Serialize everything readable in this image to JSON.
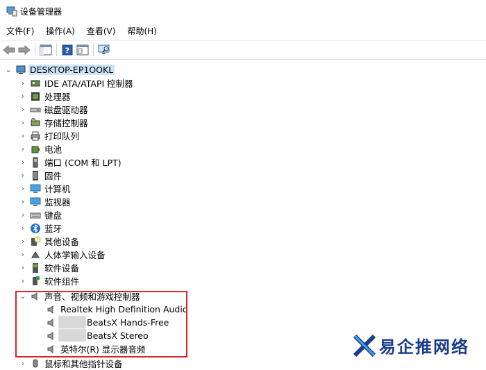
{
  "window": {
    "title": "设备管理器"
  },
  "menu": [
    "文件(F)",
    "操作(A)",
    "查看(V)",
    "帮助(H)"
  ],
  "tree": {
    "root": "DESKTOP-EP1OOKL",
    "categories": [
      {
        "label": "IDE ATA/ATAPI 控制器",
        "icon": "ide-controller-icon"
      },
      {
        "label": "处理器",
        "icon": "processor-icon"
      },
      {
        "label": "磁盘驱动器",
        "icon": "disk-drive-icon"
      },
      {
        "label": "存储控制器",
        "icon": "storage-controller-icon"
      },
      {
        "label": "打印队列",
        "icon": "printer-icon"
      },
      {
        "label": "电池",
        "icon": "battery-icon"
      },
      {
        "label": "端口 (COM 和 LPT)",
        "icon": "port-icon"
      },
      {
        "label": "固件",
        "icon": "firmware-icon"
      },
      {
        "label": "计算机",
        "icon": "computer-icon"
      },
      {
        "label": "监视器",
        "icon": "monitor-icon"
      },
      {
        "label": "键盘",
        "icon": "keyboard-icon"
      },
      {
        "label": "蓝牙",
        "icon": "bluetooth-icon"
      },
      {
        "label": "其他设备",
        "icon": "other-devices-icon"
      },
      {
        "label": "人体学输入设备",
        "icon": "hid-icon"
      },
      {
        "label": "软件设备",
        "icon": "software-device-icon"
      },
      {
        "label": "软件组件",
        "icon": "software-component-icon"
      },
      {
        "label": "声音、视频和游戏控制器",
        "icon": "speaker-icon",
        "expanded": true
      },
      {
        "label": "鼠标和其他指针设备",
        "icon": "mouse-icon"
      }
    ],
    "audio_children": [
      "Realtek High Definition Audio",
      "BeatsX Hands-Free",
      "BeatsX Stereo",
      "英特尔(R) 显示器音频"
    ]
  },
  "watermark": {
    "text": "易企推网络"
  }
}
